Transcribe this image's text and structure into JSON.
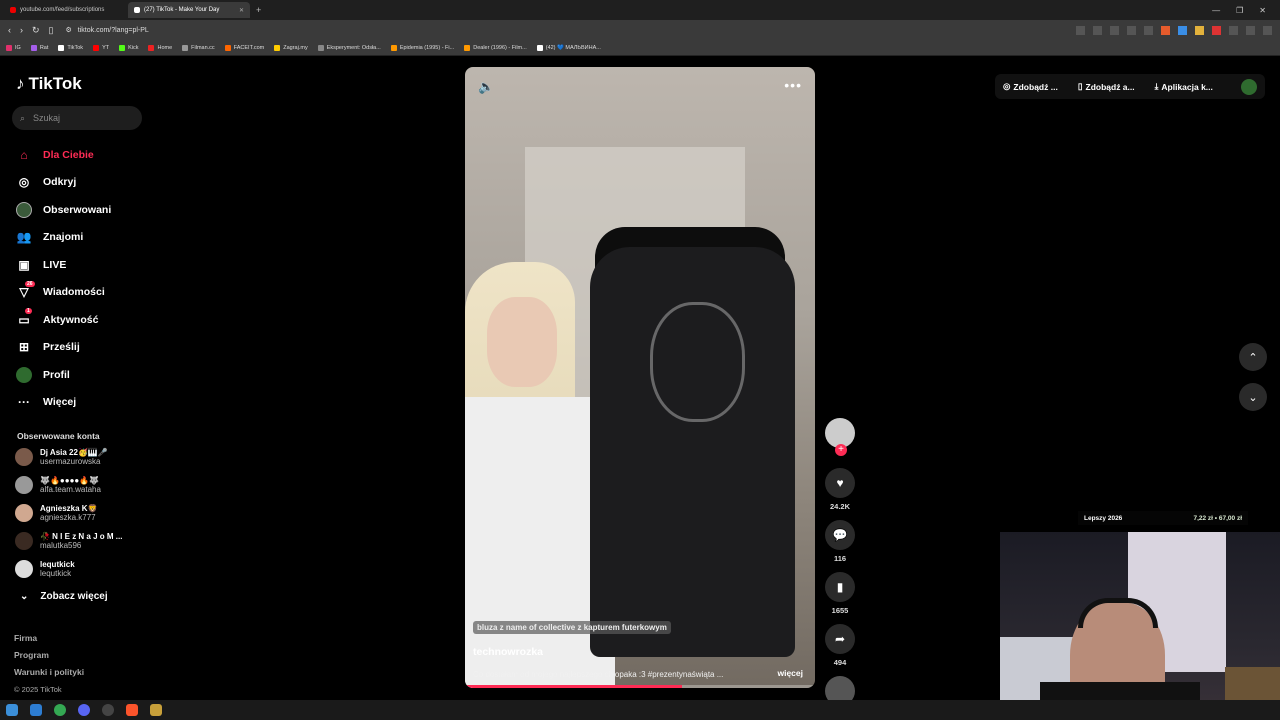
{
  "browser": {
    "tabs": [
      {
        "label": "youtube.com/feed/subscriptions"
      },
      {
        "label": "(27) TikTok - Make Your Day",
        "close": "✕"
      }
    ],
    "new_tab": "+",
    "url": "tiktok.com/?lang=pl-PL",
    "bookmarks": [
      "IG",
      "Rat",
      "TikTok",
      "YT",
      "Kick",
      "Home",
      "Filman.cc",
      "FACEIT.com",
      "Zagraj.my",
      "Eksperyment: Odsła...",
      "Epidemia (1995) - Fi...",
      "Dealer (1996) - Film...",
      "(42) 💙 МАЛЬВИНА..."
    ]
  },
  "sidebar": {
    "logo": "TikTok",
    "search_placeholder": "Szukaj",
    "nav": [
      {
        "label": "Dla Ciebie",
        "icon": "home-icon",
        "active": true
      },
      {
        "label": "Odkryj",
        "icon": "compass-icon"
      },
      {
        "label": "Obserwowani",
        "icon": "following-avatar-icon"
      },
      {
        "label": "Znajomi",
        "icon": "friends-icon"
      },
      {
        "label": "LIVE",
        "icon": "live-icon"
      },
      {
        "label": "Wiadomości",
        "icon": "messages-icon",
        "badge": "26"
      },
      {
        "label": "Aktywność",
        "icon": "activity-icon",
        "badge": "1"
      },
      {
        "label": "Prześlij",
        "icon": "upload-icon"
      },
      {
        "label": "Profil",
        "icon": "profile-icon"
      },
      {
        "label": "Więcej",
        "icon": "more-icon"
      }
    ],
    "following_title": "Obserwowane konta",
    "accounts": [
      {
        "name": "Dj Asia 22🥳🎹🎤",
        "username": "usermazurowska"
      },
      {
        "name": "🐺🔥●●●●🔥🐺",
        "username": "alfa.team.wataha"
      },
      {
        "name": "Agnieszka K🦁",
        "username": "agnieszka.k777"
      },
      {
        "name": "🥀 N I E z N a J o M ...",
        "username": "malutka596"
      },
      {
        "name": "lequtkick",
        "username": "lequtkick"
      }
    ],
    "see_more": "Zobacz więcej",
    "footer": [
      "Firma",
      "Program",
      "Warunki i polityki"
    ],
    "copyright": "© 2025 TikTok"
  },
  "video": {
    "tag": "bluza z name of collective z kapturem futerkowym",
    "author": "technowrozka",
    "description": "Co dostałam od mojego najlepszego chłopaka :3 #prezentynaświąta ...",
    "more": "więcej",
    "progress": 0.62
  },
  "actions": {
    "likes": "24.2K",
    "comments": "116",
    "saves": "1655",
    "shares": "494"
  },
  "topbar": {
    "get_coins": "Zdobądź ...",
    "get_app": "Zdobądź a...",
    "desktop_app": "Aplikacja k..."
  },
  "overlay": {
    "label": "Lepszy 2026",
    "prices": "7,22 zł • 67,00 zł"
  },
  "colors": {
    "accent": "#fe2c55"
  }
}
